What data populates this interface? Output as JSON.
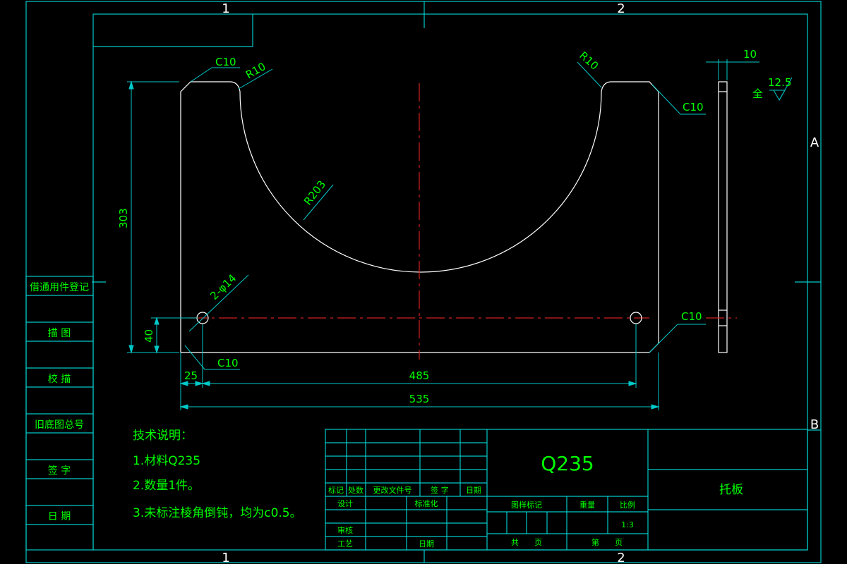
{
  "grid": {
    "top": [
      "1",
      "2"
    ],
    "bottom": [
      "1",
      "2"
    ],
    "right": [
      "A",
      "B"
    ]
  },
  "dimensions": {
    "chamfer_top_left": "C10",
    "fillet_left": "R10",
    "fillet_right": "R10",
    "chamfer_top_right": "C10",
    "arc_radius": "R203",
    "height_total": "303",
    "hole_spec": "2-φ14",
    "hole_height": "40",
    "chamfer_bottom_left": "C10",
    "chamfer_bottom_right": "C10",
    "edge_offset": "25",
    "hole_spacing": "485",
    "width_total": "535",
    "thickness": "10",
    "roughness_prefix": "全",
    "roughness_value": "12.5"
  },
  "side_panel": [
    "借通用件登记",
    "描 图",
    "校 描",
    "旧底图总号",
    "签 字",
    "日 期"
  ],
  "notes": {
    "title": "技术说明：",
    "lines": [
      "1.材料Q235",
      "2.数量1件。",
      "3.未标注棱角倒钝，均为c0.5。"
    ]
  },
  "title_block": {
    "revision_headers": [
      "标记",
      "处数",
      "更改文件号",
      "签 字",
      "日期"
    ],
    "design": "设计",
    "standardization": "标准化",
    "review": "审核",
    "process": "工艺",
    "date": "日期",
    "material": "Q235",
    "drawing_mark": "图样标记",
    "weight": "重量",
    "scale_label": "比例",
    "scale_value": "1:3",
    "total": "共　　页",
    "sheet": "第　　页",
    "part_name": "托板"
  },
  "colors": {
    "frame": "#00c8c8",
    "part": "#ffffff",
    "text": "#00ff00",
    "centerline": "#d02020",
    "background": "#000000"
  }
}
